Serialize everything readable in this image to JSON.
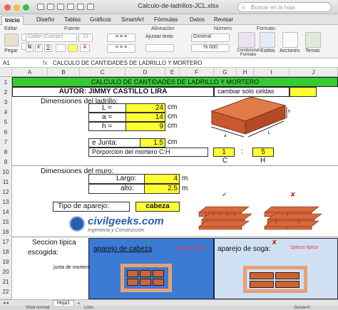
{
  "window": {
    "title": "Calculo-de-ladrillos-JCL.xlsx",
    "search_placeholder": "Buscar en la hoja"
  },
  "tabs": [
    "Inicio",
    "Diseño",
    "Tablas",
    "Gráficos",
    "SmartArt",
    "Fórmulas",
    "Datos",
    "Revisar"
  ],
  "ribbon": {
    "groups": [
      "Editar",
      "Fuente",
      "Alineación",
      "Número",
      "Formato"
    ],
    "paste": "Pegar",
    "font_name": "Calibri (Cuerpo)",
    "font_size": "12",
    "align_label": "Ajustar texto",
    "number_format": "General",
    "cond_format": "Condicional Formato",
    "styles": "Estilos",
    "actions": "Acciones",
    "themes": "Temas"
  },
  "formula_bar": {
    "cell": "A1",
    "content": "CALCULO DE CANTIDADES DE LADRILLO Y MORTERO"
  },
  "columns": [
    "A",
    "B",
    "C",
    "D",
    "E",
    "F",
    "G",
    "H",
    "I",
    "J"
  ],
  "rows": [
    "1",
    "2",
    "3",
    "4",
    "5",
    "6",
    "7",
    "8",
    "9",
    "10",
    "11",
    "12",
    "13",
    "14",
    "15",
    "16",
    "17",
    "18",
    "19",
    "20",
    "21",
    "22"
  ],
  "sheet": {
    "banner": "CALCULO DE CANTIDADES DE LADRILLO Y MORTERO",
    "author": "AUTOR: JIMMY CASTILLO LIRA",
    "note": "cambiar solo celdas",
    "brick_dims": "Dimensiones del ladrillo:",
    "L_label": "L =",
    "L_val": "24",
    "a_label": "a =",
    "a_val": "14",
    "h_label": "h =",
    "h_val": "9",
    "unit": "cm",
    "junta_label": "e Junta:",
    "junta_val": "1.5",
    "prop_label": "Porporcion del mortero C:H",
    "prop_c": "1",
    "prop_sep": ":",
    "prop_h": "5",
    "c_lbl": "C",
    "h_lbl": "H",
    "wall_dims": "Dimensiones del muro:",
    "largo_label": "Largo:",
    "largo_val": "4",
    "alto_label": "alto:",
    "alto_val": "2.5",
    "m": "m",
    "aparejo_label": "Tipo de aparejo:",
    "aparejo_val": "cabeza",
    "logo": "civilgeeks.com",
    "logo_sub": "Ingeniería y Construcción",
    "seccion": "Seccion tipica",
    "escogida": "escogida:",
    "cabeza_title": "aparejo de cabeza",
    "soga_title": "aparejo de soga:",
    "pieza_tipica": "1pieza tipica",
    "junta_mortero": "junta de mortero"
  },
  "sheet_tabs": [
    "Hoja1"
  ],
  "status": {
    "view": "Vista normal",
    "state": "Listo",
    "sum": "Suma=0"
  },
  "colors": {
    "banner": "#33cc33",
    "yellow": "#ffff33",
    "blue": "#3b7bd6",
    "soga_bg": "#cfe0f2",
    "border_blue": "#4a7fc8"
  }
}
